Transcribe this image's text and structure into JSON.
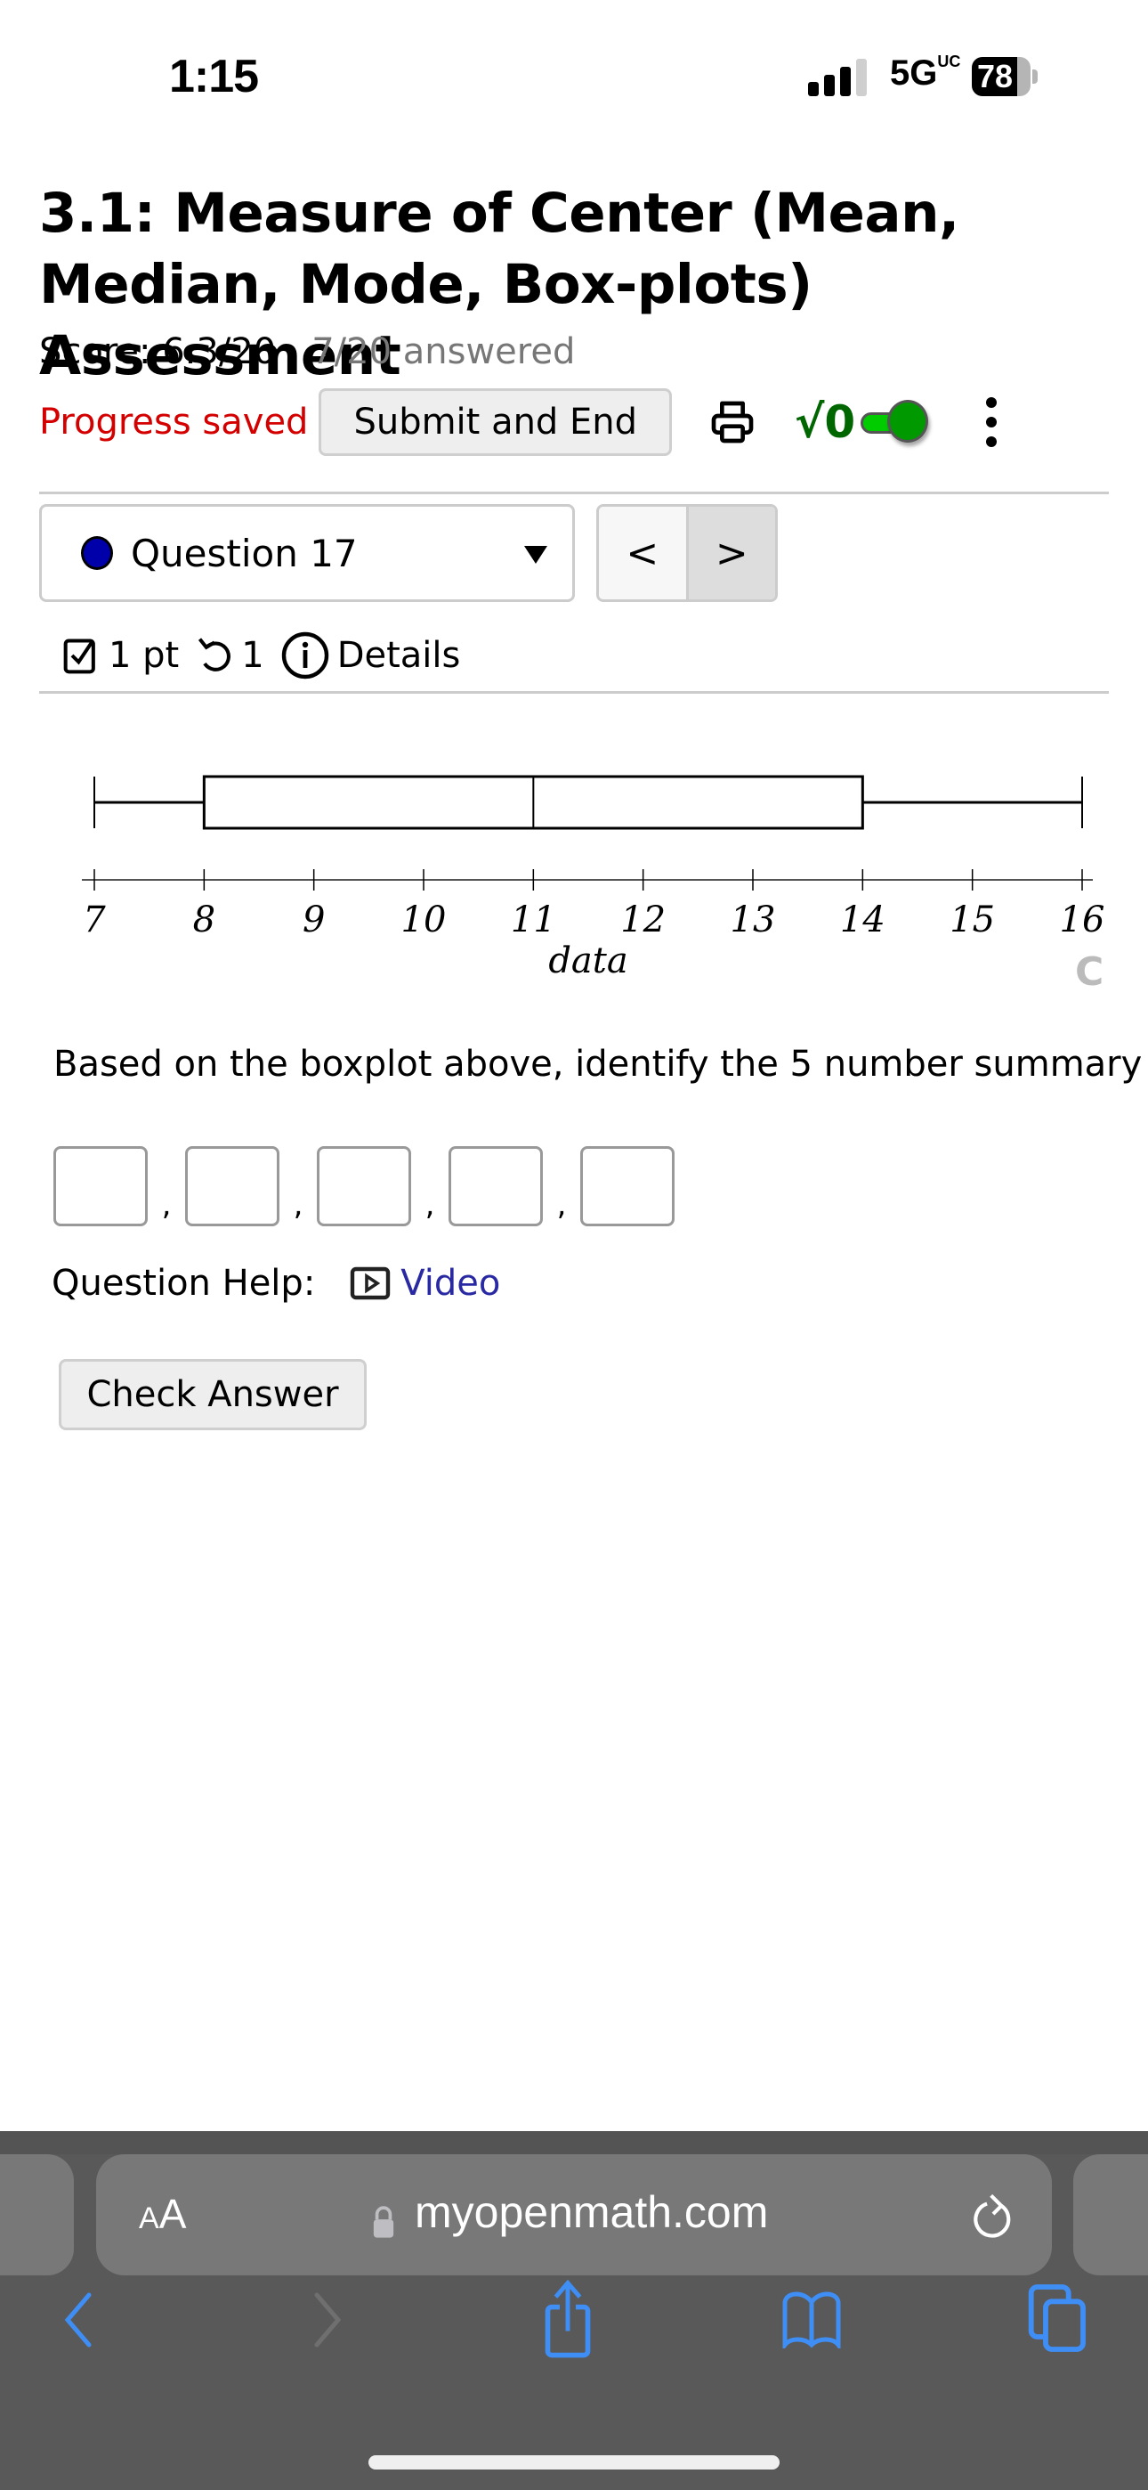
{
  "status_bar": {
    "time": "1:15",
    "network": "5G",
    "network_sup": "UC",
    "battery_level": "78",
    "battery_fraction": 0.78,
    "signal_bars_active": 3,
    "signal_bars_total": 4
  },
  "assessment": {
    "title": "3.1: Measure of Center (Mean, Median, Mode, Box-plots) Assessment",
    "score": "Score: 6.3/20",
    "answered": "7/20 answered",
    "progress_status": "Progress saved",
    "submit_label": "Submit and End",
    "math_toggle_label": "√0",
    "math_toggle_on": true,
    "colors": {
      "progress_saved": "#d40000",
      "math_toggle": "#006600",
      "question_dot": "#0000aa",
      "video_link": "#2929a3"
    }
  },
  "question_nav": {
    "selected": "Question 17",
    "prev_label": "<",
    "next_label": ">"
  },
  "question_info": {
    "points": "1 pt",
    "attempts": "1",
    "details_label": "Details"
  },
  "chart_data": {
    "type": "boxplot",
    "xlabel": "data",
    "xlim": [
      7,
      16
    ],
    "ticks": [
      7,
      8,
      9,
      10,
      11,
      12,
      13,
      14,
      15,
      16
    ],
    "tick_labels": [
      "7",
      "8",
      "9",
      "10",
      "11",
      "12",
      "13",
      "14",
      "15",
      "16"
    ],
    "min": 7,
    "q1": 8,
    "median": 11,
    "q3": 14,
    "max": 16,
    "grid": false
  },
  "reload_glyph": "C",
  "question": {
    "prompt": "Based on the boxplot above, identify the 5 number summary",
    "answers": [
      "",
      "",
      "",
      "",
      ""
    ],
    "separator": ",",
    "help_label": "Question Help:",
    "video_label": "Video",
    "check_label": "Check Answer"
  },
  "browser": {
    "text_size_label_small": "A",
    "text_size_label_large": "A",
    "url": "myopenmath.com"
  }
}
